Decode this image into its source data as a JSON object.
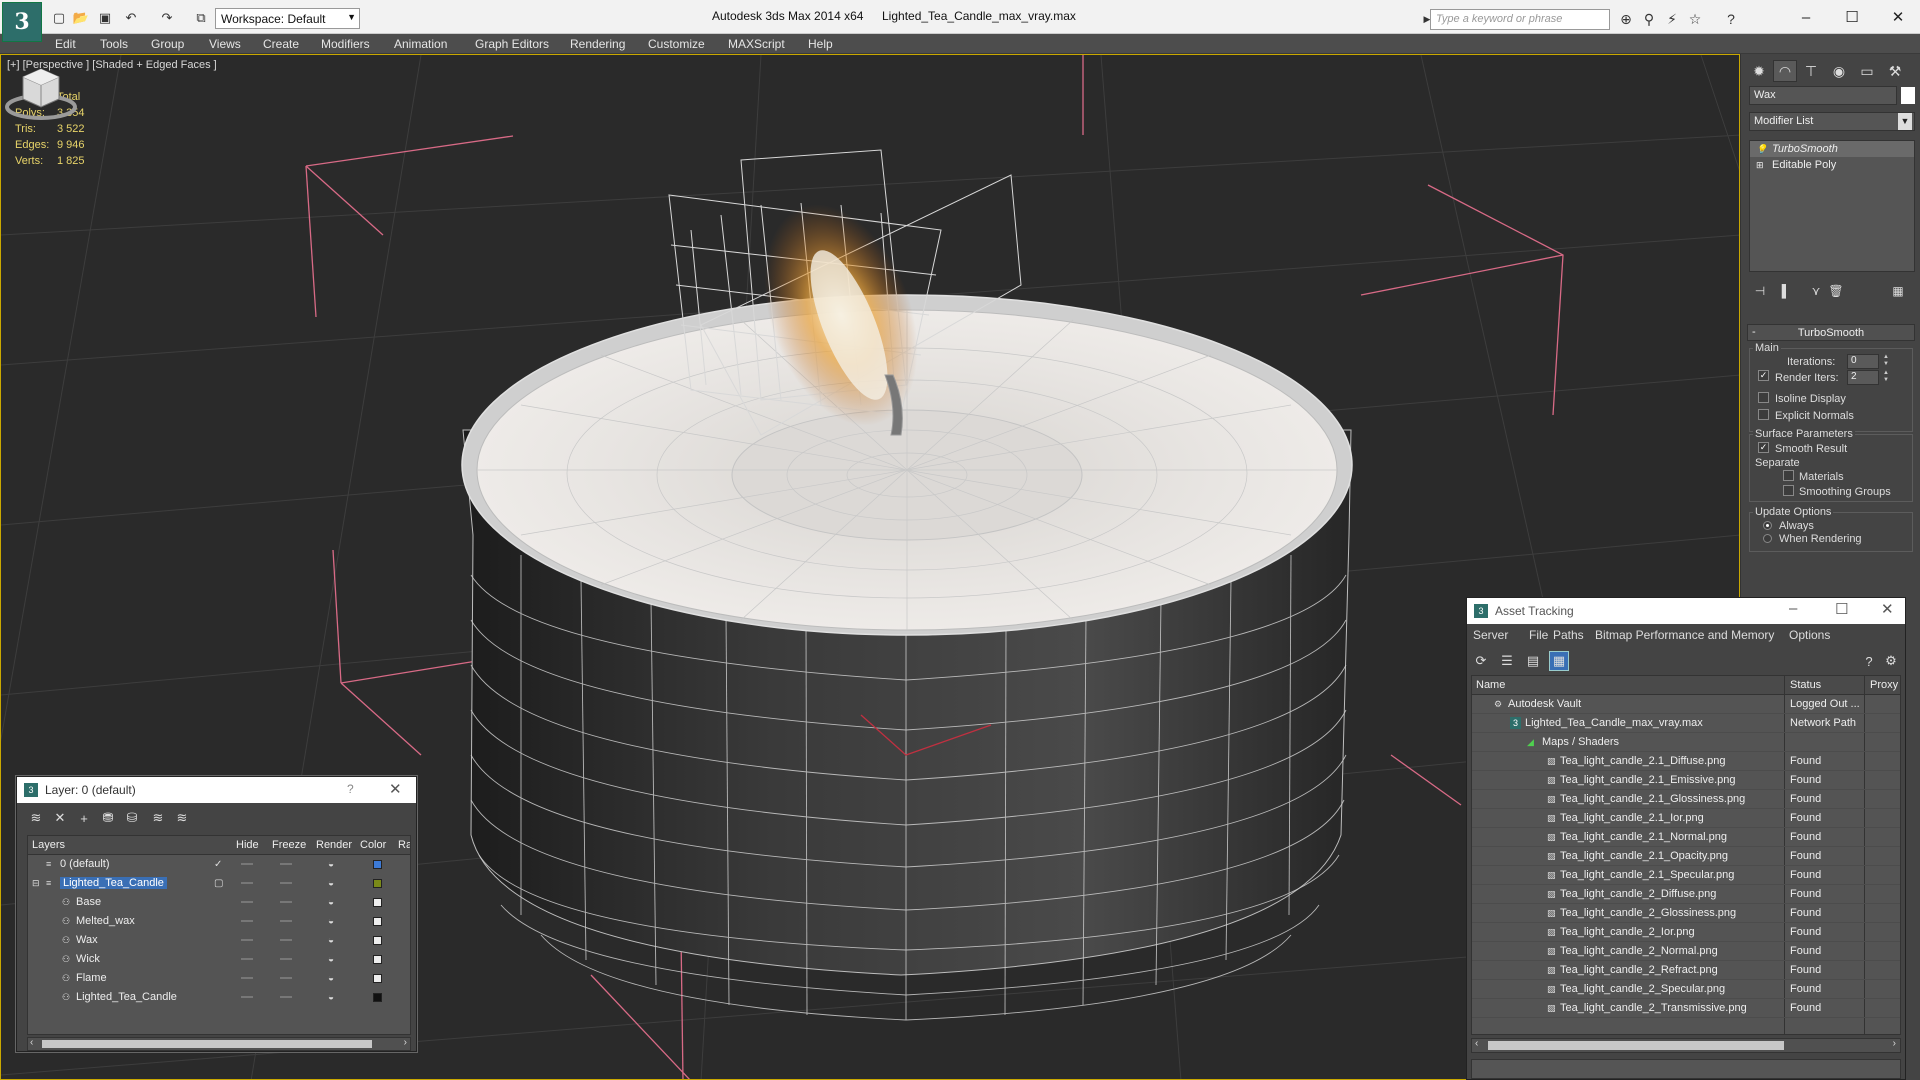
{
  "titlebar": {
    "workspace": "Workspace: Default",
    "app_title": "Autodesk 3ds Max  2014 x64",
    "file_title": "Lighted_Tea_Candle_max_vray.max",
    "search_placeholder": "Type a keyword or phrase",
    "controls": {
      "minimize": "–",
      "maximize": "☐",
      "close": "✕"
    }
  },
  "menu": [
    "Edit",
    "Tools",
    "Group",
    "Views",
    "Create",
    "Modifiers",
    "Animation",
    "Graph Editors",
    "Rendering",
    "Customize",
    "MAXScript",
    "Help"
  ],
  "viewport": {
    "label": "[+] [Perspective ] [Shaded + Edged Faces ]",
    "stats": {
      "header": "Total",
      "rows": [
        {
          "label": "Polys:",
          "value": "3 354"
        },
        {
          "label": "Tris:",
          "value": "3 522"
        },
        {
          "label": "Edges:",
          "value": "9 946"
        },
        {
          "label": "Verts:",
          "value": "1 825"
        }
      ]
    }
  },
  "command_panel": {
    "object_name": "Wax",
    "modifier_list": "Modifier List",
    "stack": [
      "TurboSmooth",
      "Editable Poly"
    ],
    "rollout": {
      "title": "TurboSmooth",
      "main_group": "Main",
      "iterations_label": "Iterations:",
      "iterations_value": "0",
      "render_iters_label": "Render Iters:",
      "render_iters_value": "2",
      "isoline_label": "Isoline Display",
      "explicit_label": "Explicit Normals",
      "surface_group": "Surface Parameters",
      "smooth_result_label": "Smooth Result",
      "separate_label": "Separate",
      "materials_label": "Materials",
      "smoothing_groups_label": "Smoothing Groups",
      "update_group": "Update Options",
      "always_label": "Always",
      "when_rendering_label": "When Rendering"
    }
  },
  "layer_dialog": {
    "title": "Layer: 0 (default)",
    "help": "?",
    "columns": [
      "Layers",
      "Hide",
      "Freeze",
      "Render",
      "Color",
      "Ra"
    ],
    "rows": [
      {
        "name": "0 (default)",
        "color": "#3c7ad6"
      },
      {
        "name": "Lighted_Tea_Candle",
        "color": "#7a8a18"
      },
      {
        "name": "Base",
        "color": "#eeeeee"
      },
      {
        "name": "Melted_wax",
        "color": "#eeeeee"
      },
      {
        "name": "Wax",
        "color": "#eeeeee"
      },
      {
        "name": "Wick",
        "color": "#eeeeee"
      },
      {
        "name": "Flame",
        "color": "#eeeeee"
      },
      {
        "name": "Lighted_Tea_Candle",
        "color": "#111111"
      }
    ]
  },
  "asset_dialog": {
    "title": "Asset Tracking",
    "menu": [
      "Server",
      "File",
      "Paths",
      "Bitmap Performance and Memory",
      "Options"
    ],
    "columns": [
      "Name",
      "Status",
      "Proxy"
    ],
    "rows": [
      {
        "name": "Autodesk Vault",
        "status": "Logged Out ..."
      },
      {
        "name": "Lighted_Tea_Candle_max_vray.max",
        "status": "Network Path"
      },
      {
        "name": "Maps / Shaders",
        "status": ""
      },
      {
        "name": "Tea_light_candle_2.1_Diffuse.png",
        "status": "Found"
      },
      {
        "name": "Tea_light_candle_2.1_Emissive.png",
        "status": "Found"
      },
      {
        "name": "Tea_light_candle_2.1_Glossiness.png",
        "status": "Found"
      },
      {
        "name": "Tea_light_candle_2.1_Ior.png",
        "status": "Found"
      },
      {
        "name": "Tea_light_candle_2.1_Normal.png",
        "status": "Found"
      },
      {
        "name": "Tea_light_candle_2.1_Opacity.png",
        "status": "Found"
      },
      {
        "name": "Tea_light_candle_2.1_Specular.png",
        "status": "Found"
      },
      {
        "name": "Tea_light_candle_2_Diffuse.png",
        "status": "Found"
      },
      {
        "name": "Tea_light_candle_2_Glossiness.png",
        "status": "Found"
      },
      {
        "name": "Tea_light_candle_2_Ior.png",
        "status": "Found"
      },
      {
        "name": "Tea_light_candle_2_Normal.png",
        "status": "Found"
      },
      {
        "name": "Tea_light_candle_2_Refract.png",
        "status": "Found"
      },
      {
        "name": "Tea_light_candle_2_Specular.png",
        "status": "Found"
      },
      {
        "name": "Tea_light_candle_2_Transmissive.png",
        "status": "Found"
      }
    ]
  },
  "colors": {
    "viewport_bg": "#2a2a2a",
    "stats_text": "#e8d469",
    "selection": "#3a6fb5",
    "active_border": "#c9a800"
  }
}
